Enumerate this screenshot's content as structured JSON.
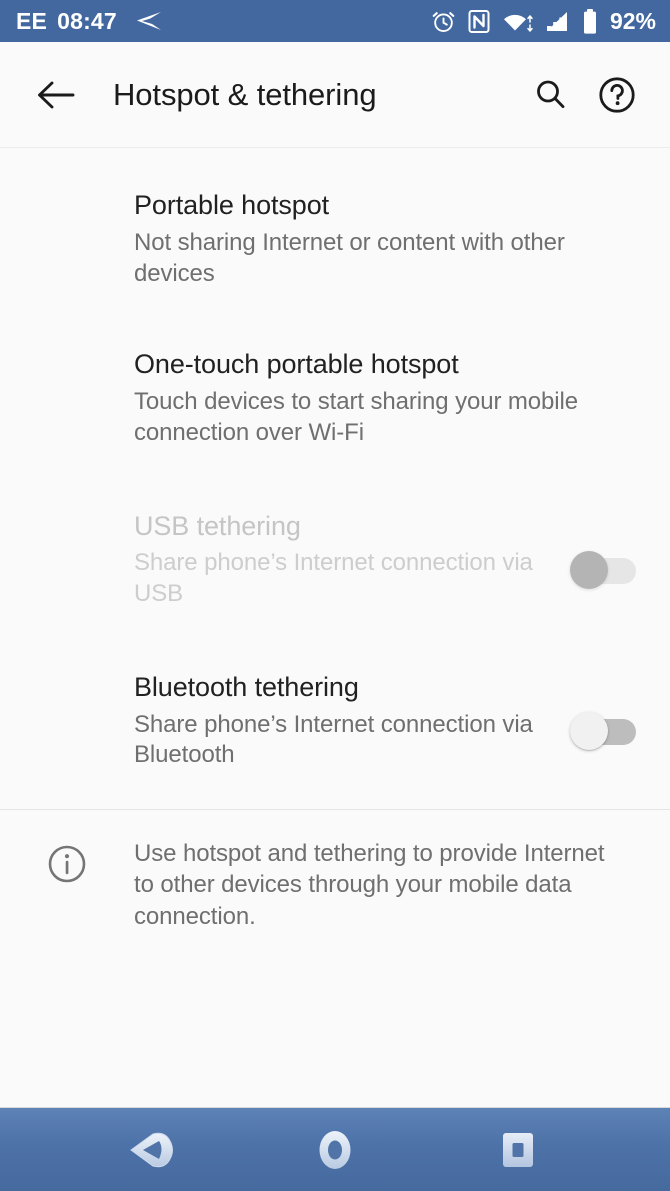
{
  "status_bar": {
    "carrier": "EE",
    "time": "08:47",
    "notification_icon": "send-arrow-icon",
    "icons": [
      "alarm-icon",
      "nfc-icon",
      "wifi-icon",
      "cellular-signal-icon",
      "battery-icon"
    ],
    "battery_percent": "92%",
    "background_color": "#43689f",
    "text_color": "#ffffff"
  },
  "app_bar": {
    "back_label": "back-arrow",
    "title": "Hotspot & tethering",
    "search_label": "search",
    "help_label": "help",
    "background_color": "#fafafa"
  },
  "preferences": [
    {
      "title": "Portable hotspot",
      "subtitle": "Not sharing Internet or content with other devices",
      "enabled": true,
      "has_toggle": false
    },
    {
      "title": "One-touch portable hotspot",
      "subtitle": "Touch devices to start sharing your mobile connection over Wi-Fi",
      "enabled": true,
      "has_toggle": false
    },
    {
      "title": "USB tethering",
      "subtitle": "Share phone’s Internet connection via USB",
      "enabled": false,
      "has_toggle": true,
      "toggle_state": "off"
    },
    {
      "title": "Bluetooth tethering",
      "subtitle": "Share phone’s Internet connection via Bluetooth",
      "enabled": true,
      "has_toggle": true,
      "toggle_state": "off"
    }
  ],
  "footer": {
    "icon": "info-icon",
    "text": "Use hotspot and tethering to provide Internet to other devices through your mobile data connection."
  },
  "nav_bar": {
    "buttons": [
      "back-nav-button",
      "home-nav-button",
      "recents-nav-button"
    ],
    "background_color": "#4d72a8"
  }
}
